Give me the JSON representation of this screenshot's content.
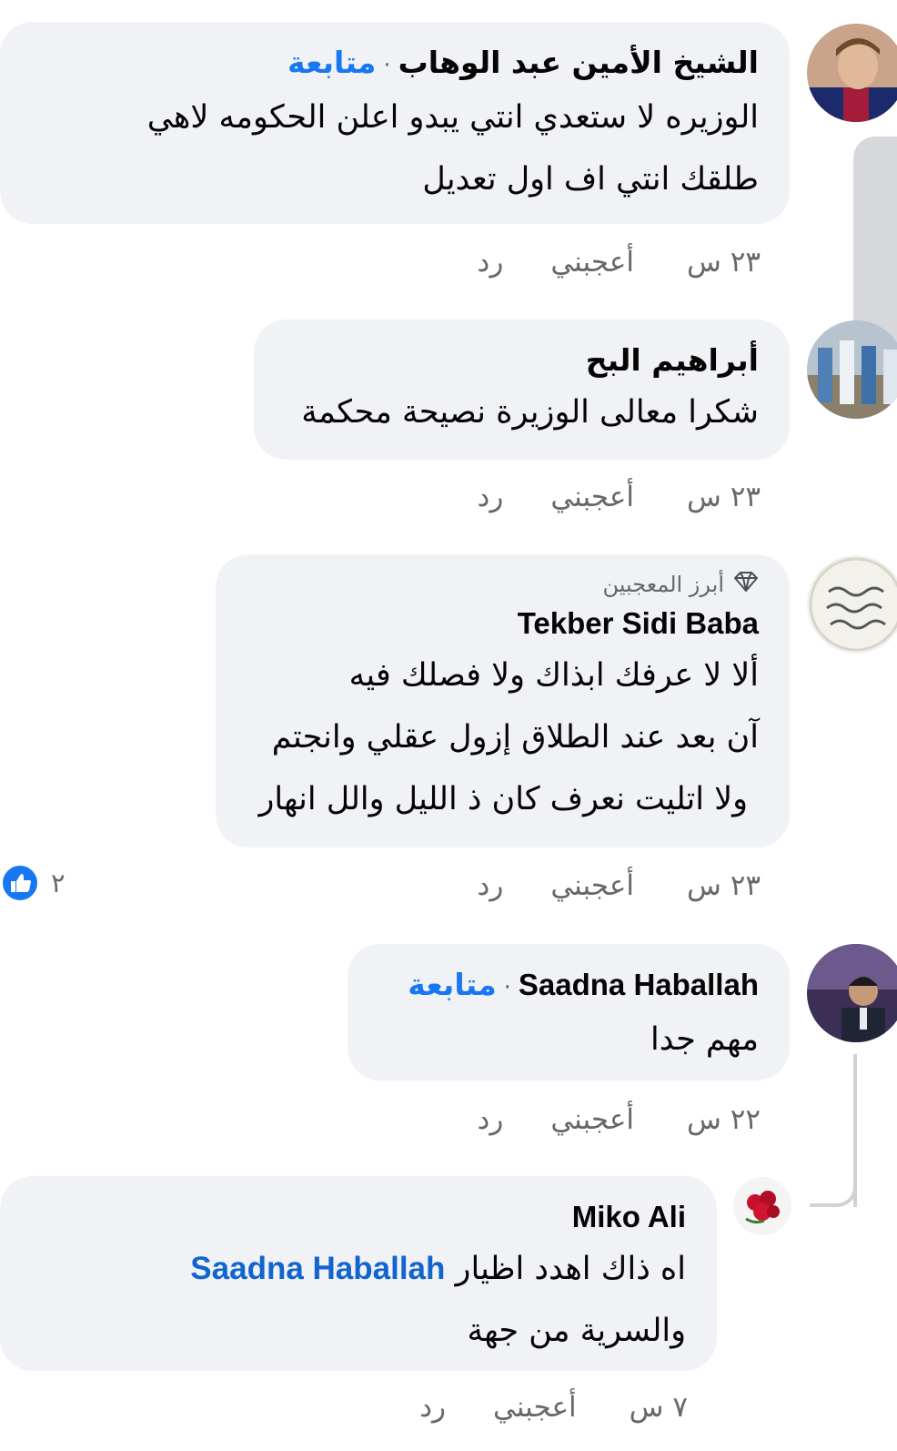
{
  "comments": [
    {
      "name": "الشيخ الأمين عبد الوهاب",
      "separator": "·",
      "follow": "متابعة",
      "lines": [
        "الوزيره لا ستعدي انتي يبدو اعلن الحكومه لاهي",
        "طلقك انتي اف اول تعديل"
      ],
      "time": "٢٣ س",
      "like": "أعجبني",
      "reply": "رد"
    },
    {
      "name": "أبراهيم البح",
      "lines": [
        "شكرا معالى الوزيرة نصيحة محكمة"
      ],
      "time": "٢٣ س",
      "like": "أعجبني",
      "reply": "رد"
    },
    {
      "badge": "أبرز المعجبين",
      "name": "Tekber Sidi Baba",
      "lines": [
        "ألا لا عرفك ابذاك ولا فصلك فيه",
        "آن بعد عند الطلاق إزول عقلي وانجتم",
        "ولا اتليت نعرف كان ذ الليل والل انهار"
      ],
      "time": "٢٣ س",
      "like": "أعجبني",
      "reply": "رد",
      "reaction_icon": "thumbs-up-icon",
      "reaction_count": "٢"
    },
    {
      "name": "Saadna Haballah",
      "separator": "·",
      "follow": "متابعة",
      "lines": [
        "مهم جدا"
      ],
      "time": "٢٢ س",
      "like": "أعجبني",
      "reply": "رد"
    },
    {
      "name": "Miko Ali",
      "mention": "Saadna Haballah",
      "line1_text": "اه ذاك اهدد اظيار",
      "lines": [
        "والسرية من جهة"
      ],
      "time": "٧ س",
      "like": "أعجبني",
      "reply": "رد"
    }
  ],
  "colors": {
    "bubble": "#f0f2f5",
    "link": "#1877f2",
    "meta": "#65676b"
  }
}
